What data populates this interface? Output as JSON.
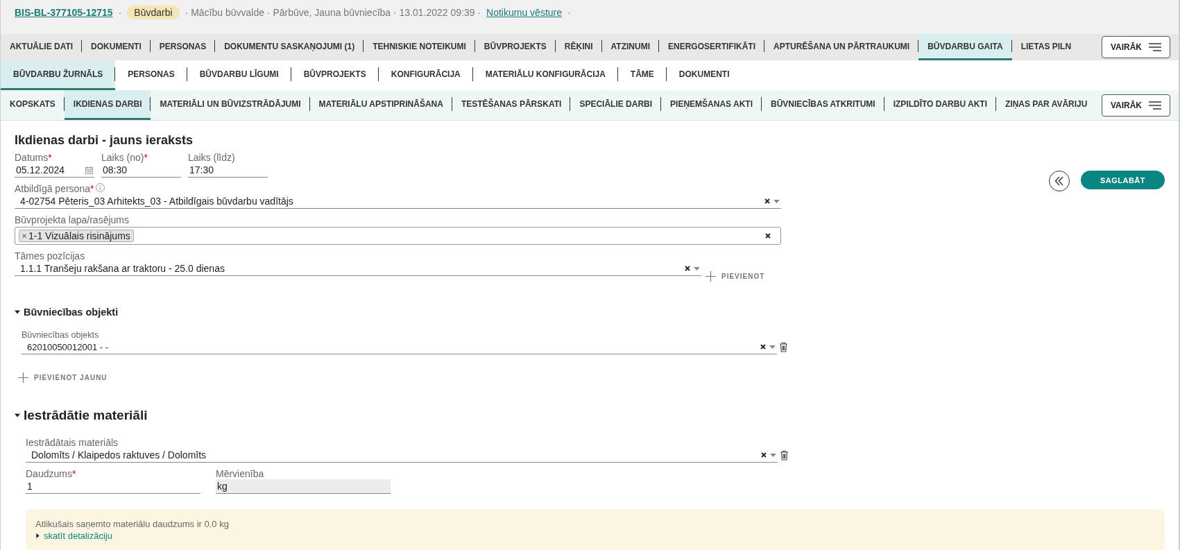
{
  "header": {
    "id_link": "BIS-BL-377105-12715",
    "separator_1": "·",
    "badge": "Būvdarbi",
    "meta": "· Mācību būvvalde · Pārbūve, Jauna būvniecība · 13.01.2022 09:39 ·",
    "history_link": "Notikumu vēsture",
    "separator_2": "·"
  },
  "main_tabs": {
    "tabs": [
      {
        "label": "AKTUĀLIE DATI",
        "selected": false
      },
      {
        "label": "DOKUMENTI",
        "selected": false
      },
      {
        "label": "PERSONAS",
        "selected": false
      },
      {
        "label": "DOKUMENTU SASKAŅOJUMI (1)",
        "selected": false
      },
      {
        "label": "TEHNISKIE NOTEIKUMI",
        "selected": false
      },
      {
        "label": "BŪVPROJEKTS",
        "selected": false
      },
      {
        "label": "RĒĶINI",
        "selected": false
      },
      {
        "label": "ATZINUMI",
        "selected": false
      },
      {
        "label": "ENERGOSERTIFIKĀTI",
        "selected": false
      },
      {
        "label": "APTURĒŠANA UN PĀRTRAUKUMI",
        "selected": false
      },
      {
        "label": "BŪVDARBU GAITA",
        "selected": true
      },
      {
        "label": "LIETAS PILN",
        "selected": false
      }
    ],
    "more": "VAIRĀK"
  },
  "journal_tabs": {
    "tabs": [
      {
        "label": "BŪVDARBU ŽURNĀLS",
        "selected": true
      },
      {
        "label": "PERSONAS",
        "selected": false
      },
      {
        "label": "BŪVDARBU LĪGUMI",
        "selected": false
      },
      {
        "label": "BŪVPROJEKTS",
        "selected": false
      },
      {
        "label": "KONFIGURĀCIJA",
        "selected": false
      },
      {
        "label": "MATERIĀLU KONFIGURĀCIJA",
        "selected": false
      },
      {
        "label": "TĀME",
        "selected": false
      },
      {
        "label": "DOKUMENTI",
        "selected": false
      }
    ]
  },
  "sub_tabs": {
    "tabs": [
      {
        "label": "KOPSKATS",
        "selected": false
      },
      {
        "label": "IKDIENAS DARBI",
        "selected": true
      },
      {
        "label": "MATERIĀLI UN BŪVIZSTRĀDĀJUMI",
        "selected": false
      },
      {
        "label": "MATERIĀLU APSTIPRINĀŠANA",
        "selected": false
      },
      {
        "label": "TESTĒŠANAS PĀRSKATI",
        "selected": false
      },
      {
        "label": "SPECIĀLIE DARBI",
        "selected": false
      },
      {
        "label": "PIEŅEMŠANAS AKTI",
        "selected": false
      },
      {
        "label": "BŪVNIECĪBAS ATKRITUMI",
        "selected": false
      },
      {
        "label": "IZPILDĪTO DARBU AKTI",
        "selected": false
      },
      {
        "label": "ZIŅAS PAR AVĀRIJU",
        "selected": false
      }
    ],
    "more": "VAIRĀK"
  },
  "form": {
    "title": "Ikdienas darbi - jauns ieraksts",
    "time_fields": [
      {
        "kind": "date",
        "label": "Datums",
        "required_mark": "*",
        "value": "05.12.2024"
      },
      {
        "kind": "text",
        "label": "Laiks (no)",
        "required_mark": "*",
        "value": "08:30"
      },
      {
        "kind": "text",
        "label": "Laiks (līdz)",
        "value": "17:30"
      }
    ],
    "responsible": {
      "label": "Atbildīgā persona",
      "required_mark": "*",
      "info": true,
      "value": "4-02754 Pēteris_03 Arhitekts_03 - Atbildīgais būvdarbu vadītājs"
    },
    "drawing": {
      "label": "Būvprojekta lapa/rasējums",
      "tags": [
        "1-1 Vizuālais risinājums"
      ]
    },
    "estimate": {
      "label": "Tāmes pozīcijas",
      "value": "1.1.1 Tranšeju rakšana ar traktoru - 25.0 dienas",
      "add_button": "PIEVIENOT"
    },
    "back_button": true,
    "save_button": "SAGLABĀT"
  },
  "objects": {
    "title": "Būvniecības objekti",
    "expanded": true,
    "label": "Būvniecības objekts",
    "value": "62010050012001 - -",
    "add_button": "PIEVIENOT JAUNU"
  },
  "materials": {
    "title": "Iestrādātie materiāli",
    "expanded": true,
    "material_label": "Iestrādātais materiāls",
    "material_value": "Dolomīts / Klaipedos raktuves / Dolomīts",
    "quantity": {
      "label": "Daudzums",
      "required_mark": "*",
      "value": "1"
    },
    "unit": {
      "label": "Mērvienība",
      "disabled": true,
      "value": "kg"
    },
    "notice": {
      "text": "Atlikušais saņemto materiālu daudzums ir 0.0 kg",
      "link": "skatīt detalizāciju",
      "expanded": false
    }
  }
}
